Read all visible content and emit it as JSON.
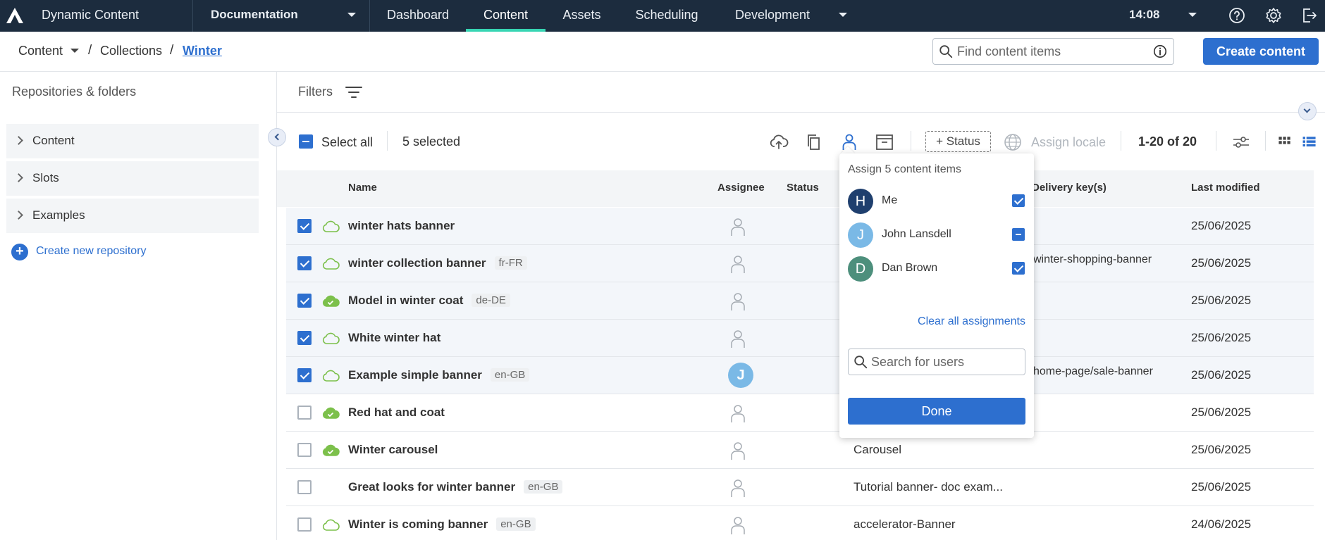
{
  "topnav": {
    "app_title": "Dynamic Content",
    "hub": "Documentation",
    "tabs": [
      {
        "label": "Dashboard",
        "active": false
      },
      {
        "label": "Content",
        "active": true
      },
      {
        "label": "Assets",
        "active": false
      },
      {
        "label": "Scheduling",
        "active": false
      },
      {
        "label": "Development",
        "active": false
      }
    ],
    "time": "14:08",
    "icons": [
      "help-icon",
      "gear-icon",
      "logout-icon"
    ]
  },
  "breadcrumb": {
    "items": [
      "Content",
      "Collections",
      "Winter"
    ],
    "separator": "/"
  },
  "search": {
    "placeholder": "Find content items"
  },
  "create_button": "Create content",
  "sidebar": {
    "title": "Repositories & folders",
    "repos": [
      "Content",
      "Slots",
      "Examples"
    ],
    "create_label": "Create new repository"
  },
  "filters": {
    "label": "Filters"
  },
  "toolbar": {
    "select_all": "Select all",
    "selected_count": "5 selected",
    "status_button": "+ Status",
    "assign_locale": "Assign locale",
    "pagination": "1-20 of 20"
  },
  "table": {
    "headers": {
      "name": "Name",
      "assignee": "Assignee",
      "status": "Status",
      "delivery_keys": "Delivery key(s)",
      "last_modified": "Last modified"
    },
    "rows": [
      {
        "checked": true,
        "cloud": "outline",
        "name": "winter hats banner",
        "locale": "",
        "assignee": "",
        "type": "",
        "key": "",
        "date": "25/06/2025"
      },
      {
        "checked": true,
        "cloud": "outline",
        "name": "winter collection banner",
        "locale": "fr-FR",
        "assignee": "",
        "type": "",
        "key": "winter-shopping-banner",
        "date": "25/06/2025"
      },
      {
        "checked": true,
        "cloud": "filled",
        "name": "Model in winter coat",
        "locale": "de-DE",
        "assignee": "",
        "type": "",
        "key": "",
        "date": "25/06/2025"
      },
      {
        "checked": true,
        "cloud": "outline",
        "name": "White winter hat",
        "locale": "",
        "assignee": "",
        "type": "",
        "key": "",
        "date": "25/06/2025"
      },
      {
        "checked": true,
        "cloud": "outline",
        "name": "Example simple banner",
        "locale": "en-GB",
        "assignee": "J",
        "type": "",
        "key": "home-page/sale-banner",
        "date": "25/06/2025"
      },
      {
        "checked": false,
        "cloud": "filled",
        "name": "Red hat and coat",
        "locale": "",
        "assignee": "",
        "type": "",
        "key": "",
        "date": "25/06/2025"
      },
      {
        "checked": false,
        "cloud": "filled",
        "name": "Winter carousel",
        "locale": "",
        "assignee": "",
        "type": "Carousel",
        "key": "",
        "date": "25/06/2025"
      },
      {
        "checked": false,
        "cloud": "none",
        "name": "Great looks for winter banner",
        "locale": "en-GB",
        "assignee": "",
        "type": "Tutorial banner- doc exam...",
        "key": "",
        "date": "25/06/2025"
      },
      {
        "checked": false,
        "cloud": "outline",
        "name": "Winter is coming banner",
        "locale": "en-GB",
        "assignee": "",
        "type": "accelerator-Banner",
        "key": "",
        "date": "24/06/2025"
      }
    ]
  },
  "assign_popover": {
    "title": "Assign 5 content items",
    "users": [
      {
        "initial": "H",
        "name": "Me",
        "state": "checked",
        "color": "#1f3f6e"
      },
      {
        "initial": "J",
        "name": "John Lansdell",
        "state": "partial",
        "color": "#7ab9e6"
      },
      {
        "initial": "D",
        "name": "Dan Brown",
        "state": "checked",
        "color": "#4d8f7c"
      }
    ],
    "clear_label": "Clear all assignments",
    "search_placeholder": "Search for users",
    "done_label": "Done"
  },
  "colors": {
    "nav_bg": "#1c2c3e",
    "accent": "#2d6fcf",
    "active_tab": "#37d5b3",
    "cloud_green": "#7cc04b"
  }
}
